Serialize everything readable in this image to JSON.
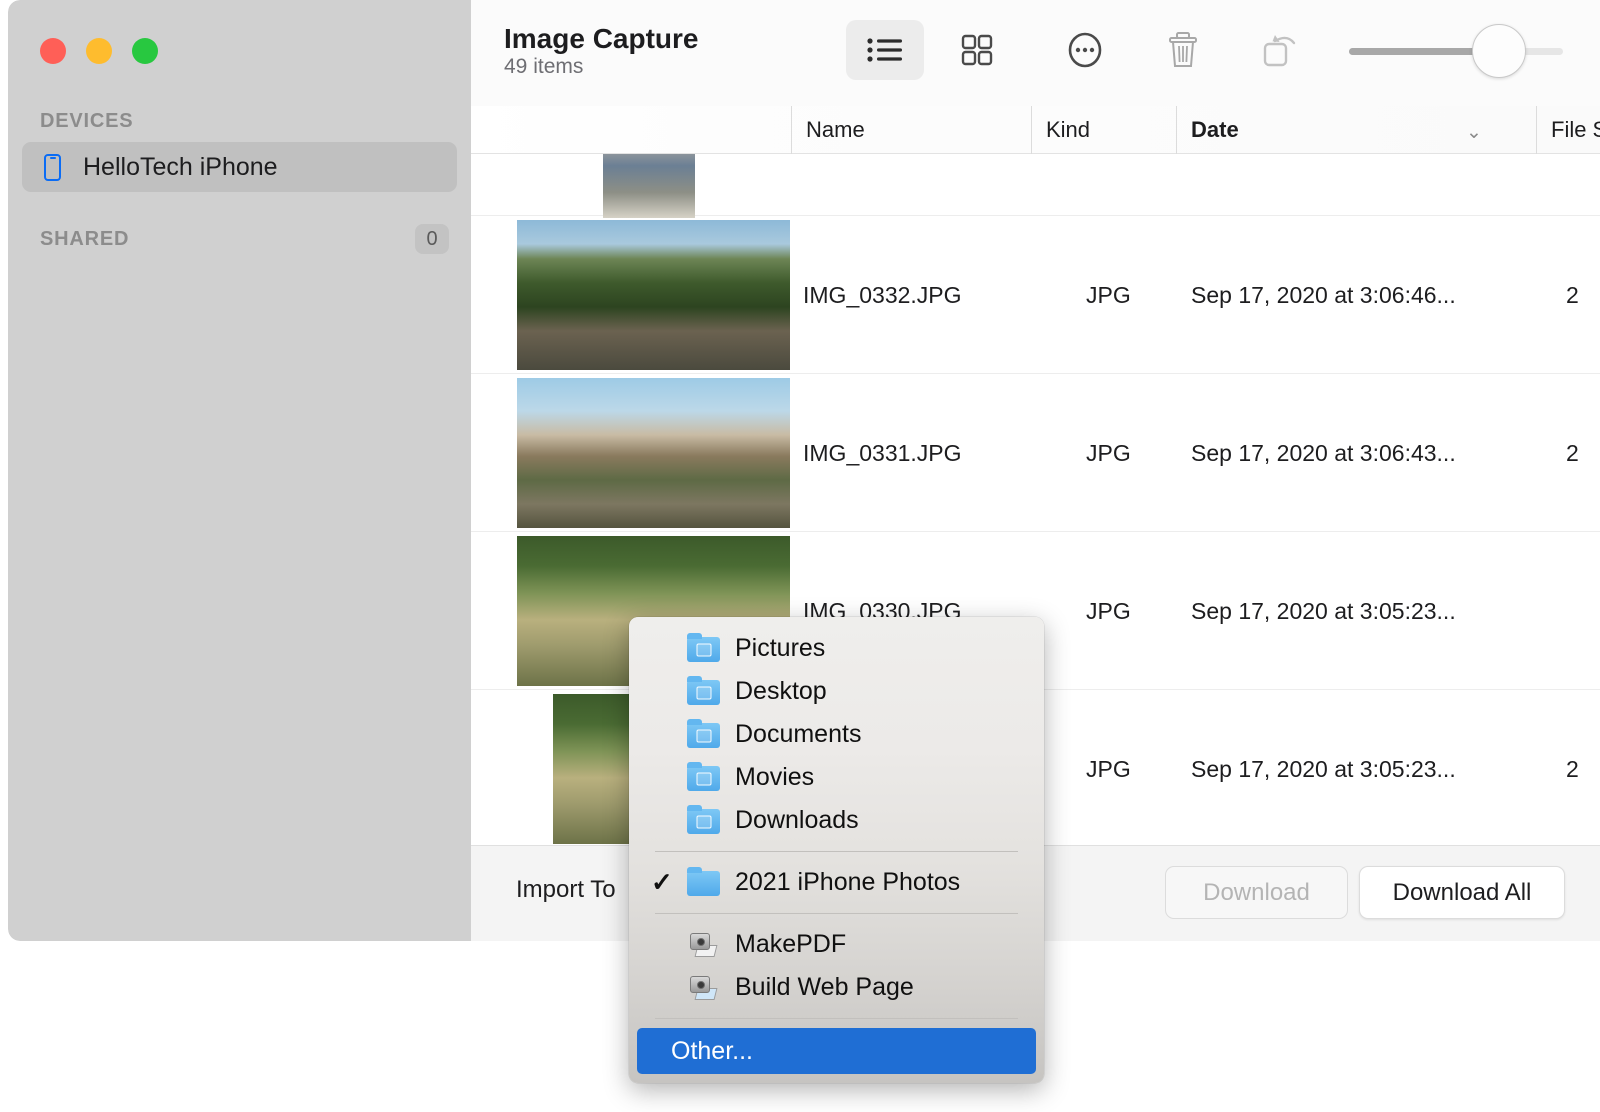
{
  "window": {
    "traffic_lights": [
      {
        "name": "close",
        "color": "#FF5F57"
      },
      {
        "name": "minimize",
        "color": "#FEBC2E"
      },
      {
        "name": "zoom",
        "color": "#28C840"
      }
    ]
  },
  "sidebar": {
    "sections": [
      {
        "header": "DEVICES",
        "count": null
      },
      {
        "header": "SHARED",
        "count": "0"
      }
    ],
    "devices": [
      {
        "label": "HelloTech iPhone",
        "icon": "iphone-icon",
        "selected": true
      }
    ]
  },
  "toolbar": {
    "title": "Image Capture",
    "subtitle": "49 items",
    "buttons": [
      {
        "name": "list-view",
        "icon": "list-view-icon",
        "active": true
      },
      {
        "name": "grid-view",
        "icon": "grid-view-icon",
        "active": false
      },
      {
        "name": "more-options",
        "icon": "ellipsis-circle-icon",
        "active": false
      },
      {
        "name": "delete",
        "icon": "trash-icon",
        "active": false
      },
      {
        "name": "rotate",
        "icon": "rotate-icon",
        "active": false
      }
    ],
    "zoom_slider": {
      "name": "thumbnail-size-slider",
      "value": 85,
      "min": 0,
      "max": 100
    }
  },
  "columns": [
    {
      "key": "name",
      "label": "Name",
      "sorted": false
    },
    {
      "key": "kind",
      "label": "Kind",
      "sorted": false
    },
    {
      "key": "date",
      "label": "Date",
      "sorted": true,
      "sort_indicator": "⌄"
    },
    {
      "key": "size",
      "label": "File S",
      "sorted": false
    }
  ],
  "files": [
    {
      "name": "",
      "kind": "",
      "date": "",
      "size": "",
      "thumb_class": "ph-d",
      "partial": true
    },
    {
      "name": "IMG_0332.JPG",
      "kind": "JPG",
      "date": "Sep 17, 2020 at 3:06:46...",
      "size": "2",
      "thumb_class": "ph-a",
      "partial": false
    },
    {
      "name": "IMG_0331.JPG",
      "kind": "JPG",
      "date": "Sep 17, 2020 at 3:06:43...",
      "size": "2",
      "thumb_class": "ph-b",
      "partial": false
    },
    {
      "name": "IMG_0330.JPG",
      "kind": "JPG",
      "date": "Sep 17, 2020 at 3:05:23...",
      "size": "",
      "thumb_class": "ph-c",
      "partial": false
    },
    {
      "name": "",
      "kind": "JPG",
      "date": "Sep 17, 2020 at 3:05:23...",
      "size": "2",
      "thumb_class": "ph-c",
      "partial": false
    }
  ],
  "bottombar": {
    "import_label": "Import To",
    "import_popup_value": "2021 iPhone Photos",
    "download_label": "Download",
    "download_disabled": true,
    "download_all_label": "Download All"
  },
  "menu": {
    "items": [
      {
        "label": "Pictures",
        "icon": "folder-pictures-icon",
        "checked": false,
        "type": "folder"
      },
      {
        "label": "Desktop",
        "icon": "folder-desktop-icon",
        "checked": false,
        "type": "folder"
      },
      {
        "label": "Documents",
        "icon": "folder-documents-icon",
        "checked": false,
        "type": "folder"
      },
      {
        "label": "Movies",
        "icon": "folder-movies-icon",
        "checked": false,
        "type": "folder"
      },
      {
        "label": "Downloads",
        "icon": "folder-downloads-icon",
        "checked": false,
        "type": "folder"
      },
      {
        "label": "2021 iPhone Photos",
        "icon": "folder-plain-icon",
        "checked": true,
        "type": "folder"
      },
      {
        "label": "MakePDF",
        "icon": "automator-icon",
        "checked": false,
        "type": "automator"
      },
      {
        "label": "Build Web Page",
        "icon": "automator-web-icon",
        "checked": false,
        "type": "automator"
      },
      {
        "label": "Other...",
        "icon": null,
        "checked": false,
        "type": "action",
        "highlighted": true
      }
    ],
    "checkmark": "✓",
    "highlight_color": "#1F6ED4"
  }
}
